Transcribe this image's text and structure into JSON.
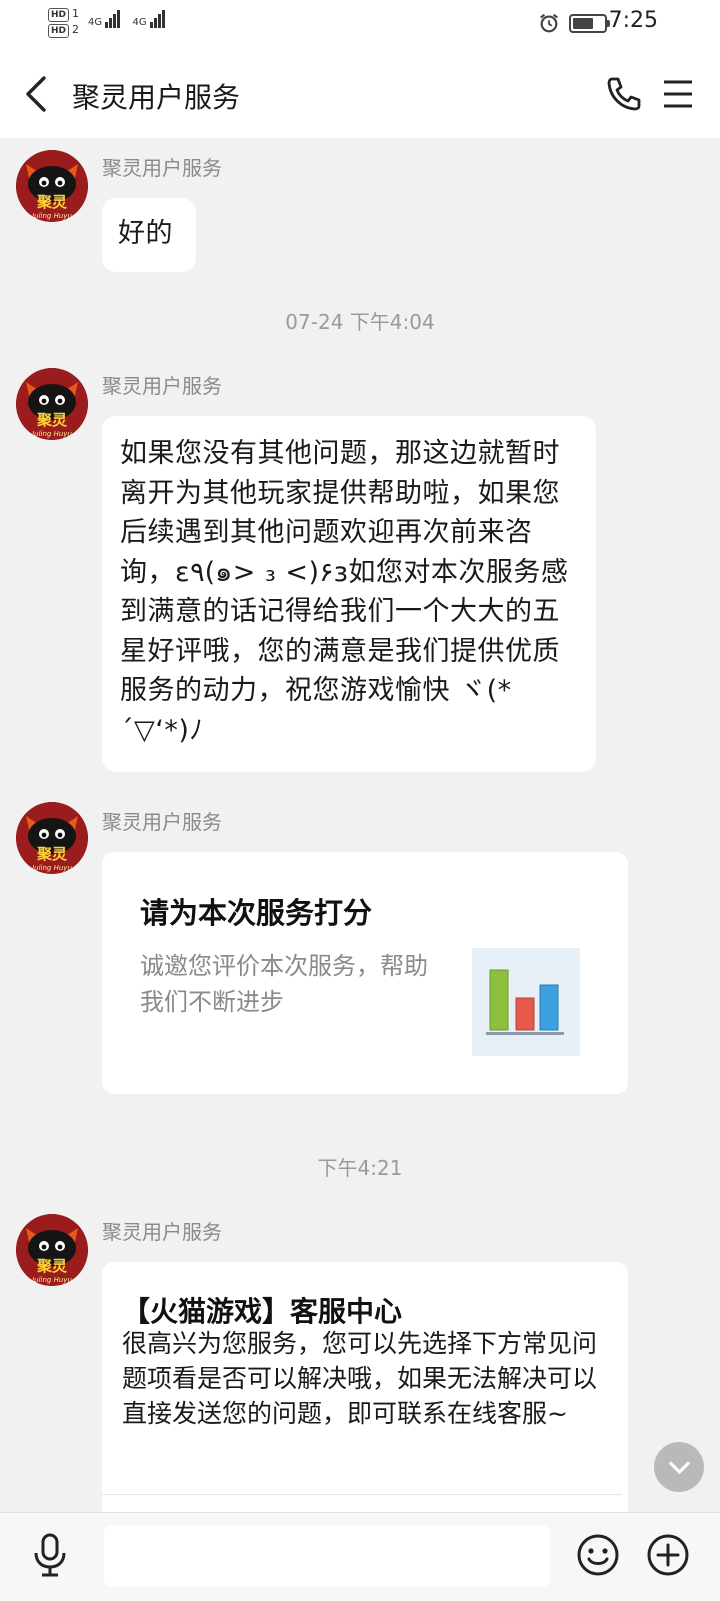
{
  "status_bar": {
    "hd1": "HD",
    "hd1_sub": "1",
    "hd2": "HD",
    "hd2_sub": "2",
    "net1": "4G",
    "net2": "4G",
    "time": "7:25"
  },
  "header": {
    "title": "聚灵用户服务"
  },
  "messages": [
    {
      "sender": "聚灵用户服务",
      "text": "好的"
    },
    {
      "sender": "聚灵用户服务",
      "text": "如果您没有其他问题，那这边就暂时离开为其他玩家提供帮助啦，如果您后续遇到其他问题欢迎再次前来咨询，ε٩(๑> ₃ <)۶з如您对本次服务感到满意的话记得给我们一个大大的五星好评哦，您的满意是我们提供优质服务的动力，祝您游戏愉快 ヾ(*´▽‘*)ﾉ"
    },
    {
      "sender": "聚灵用户服务",
      "card_title": "请为本次服务打分",
      "card_desc": "诚邀您评价本次服务，帮助我们不断进步"
    },
    {
      "sender": "聚灵用户服务",
      "title": "【火猫游戏】客服中心",
      "text": "很高兴为您服务，您可以先选择下方常见问题项看是否可以解决哦，如果无法解决可以直接发送您的问题，即可联系在线客服~"
    }
  ],
  "timestamps": [
    "07-24 下午4:04",
    "下午4:21"
  ],
  "avatar": {
    "logo_text": "聚灵",
    "sub_text": "Juling Huyu"
  },
  "input": {
    "placeholder": ""
  },
  "colors": {
    "background": "#f1f1f1",
    "bubble": "#ffffff",
    "secondary_text": "#8a8a8a",
    "chart_green": "#8dbf3f",
    "chart_red": "#e55a4a",
    "chart_blue": "#3c9fe0"
  }
}
